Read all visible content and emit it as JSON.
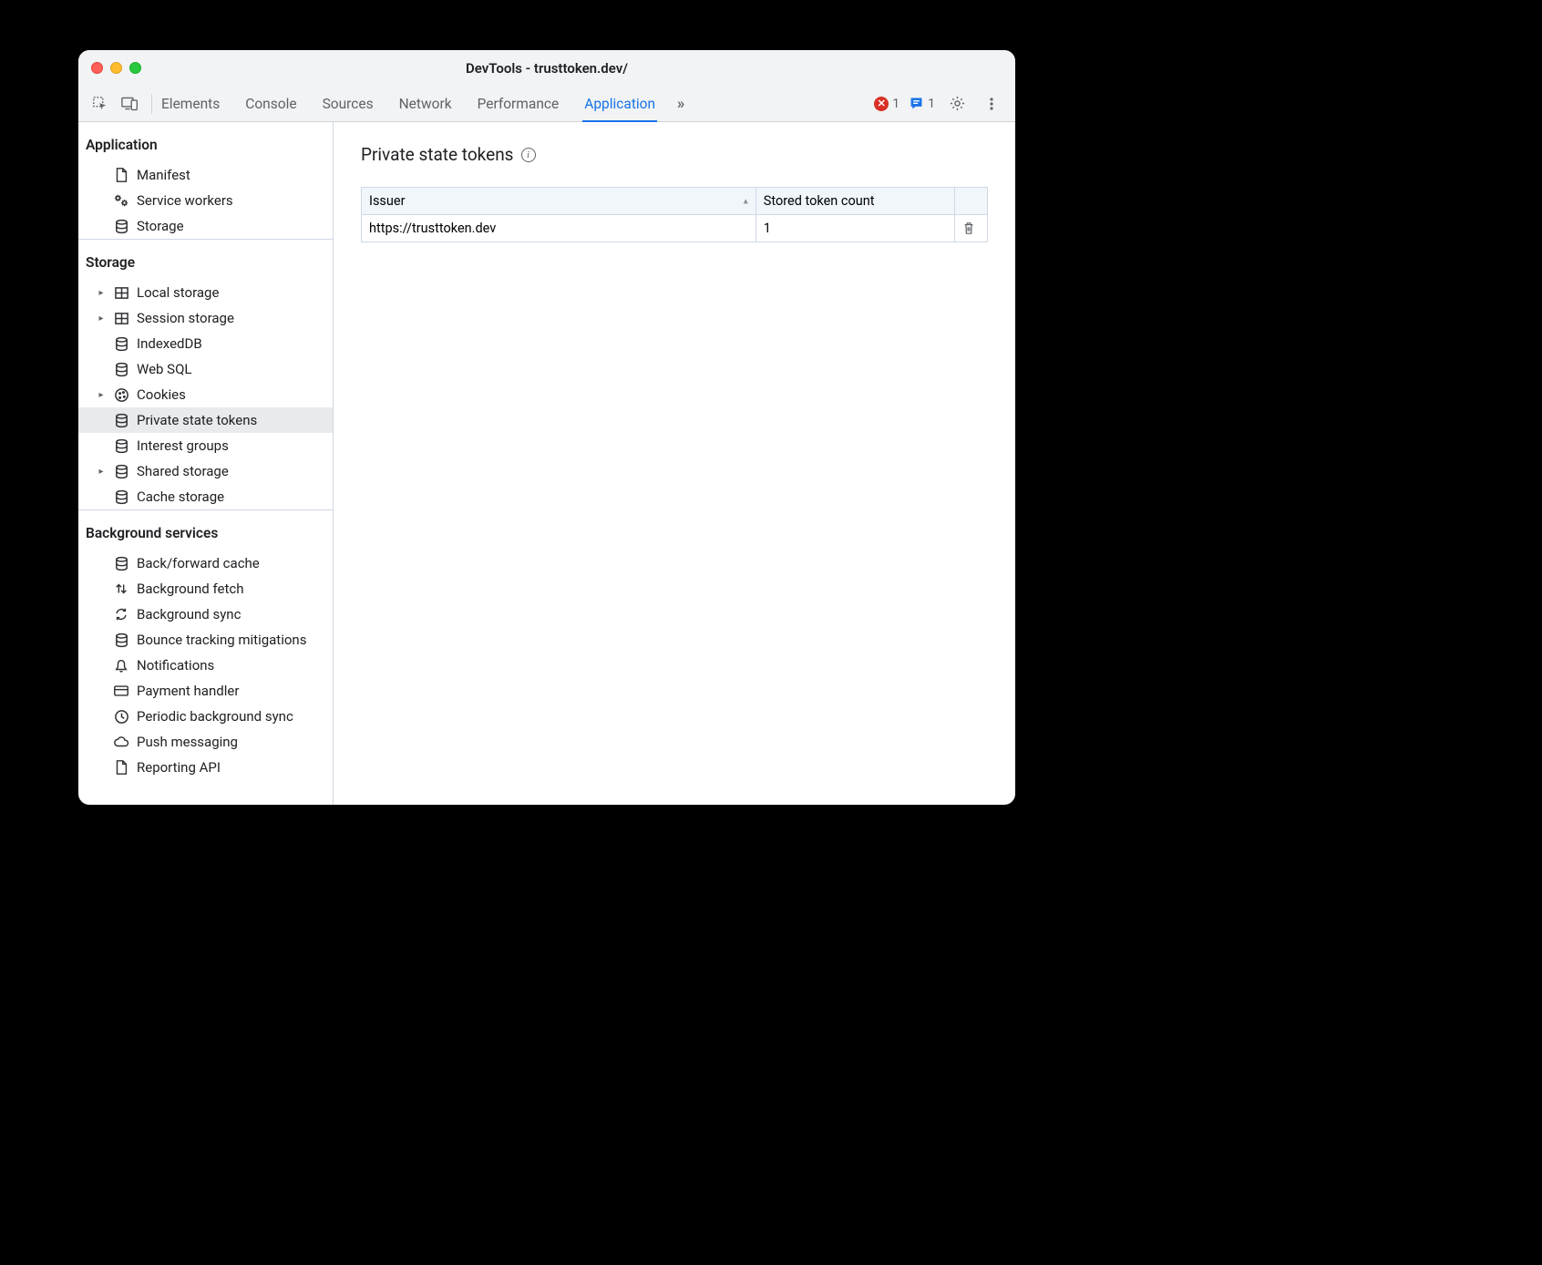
{
  "window": {
    "title": "DevTools - trusttoken.dev/"
  },
  "tabs": {
    "items": [
      "Elements",
      "Console",
      "Sources",
      "Network",
      "Performance",
      "Application"
    ],
    "active_index": 5,
    "more_glyph": "»"
  },
  "status": {
    "errors": "1",
    "messages": "1"
  },
  "sidebar": {
    "groups": [
      {
        "title": "Application",
        "items": [
          {
            "label": "Manifest",
            "icon": "file",
            "arrow": false
          },
          {
            "label": "Service workers",
            "icon": "gears",
            "arrow": false
          },
          {
            "label": "Storage",
            "icon": "db",
            "arrow": false
          }
        ]
      },
      {
        "title": "Storage",
        "items": [
          {
            "label": "Local storage",
            "icon": "grid",
            "arrow": true
          },
          {
            "label": "Session storage",
            "icon": "grid",
            "arrow": true
          },
          {
            "label": "IndexedDB",
            "icon": "db",
            "arrow": false
          },
          {
            "label": "Web SQL",
            "icon": "db",
            "arrow": false
          },
          {
            "label": "Cookies",
            "icon": "cookie",
            "arrow": true
          },
          {
            "label": "Private state tokens",
            "icon": "db",
            "arrow": false,
            "selected": true
          },
          {
            "label": "Interest groups",
            "icon": "db",
            "arrow": false
          },
          {
            "label": "Shared storage",
            "icon": "db",
            "arrow": true
          },
          {
            "label": "Cache storage",
            "icon": "db",
            "arrow": false
          }
        ]
      },
      {
        "title": "Background services",
        "items": [
          {
            "label": "Back/forward cache",
            "icon": "db",
            "arrow": false
          },
          {
            "label": "Background fetch",
            "icon": "updown",
            "arrow": false
          },
          {
            "label": "Background sync",
            "icon": "sync",
            "arrow": false
          },
          {
            "label": "Bounce tracking mitigations",
            "icon": "db",
            "arrow": false
          },
          {
            "label": "Notifications",
            "icon": "bell",
            "arrow": false
          },
          {
            "label": "Payment handler",
            "icon": "card",
            "arrow": false
          },
          {
            "label": "Periodic background sync",
            "icon": "clock",
            "arrow": false
          },
          {
            "label": "Push messaging",
            "icon": "cloud",
            "arrow": false
          },
          {
            "label": "Reporting API",
            "icon": "file",
            "arrow": false
          }
        ]
      }
    ]
  },
  "main": {
    "title": "Private state tokens",
    "table": {
      "headers": [
        "Issuer",
        "Stored token count",
        ""
      ],
      "rows": [
        {
          "issuer": "https://trusttoken.dev",
          "count": "1"
        }
      ]
    }
  }
}
